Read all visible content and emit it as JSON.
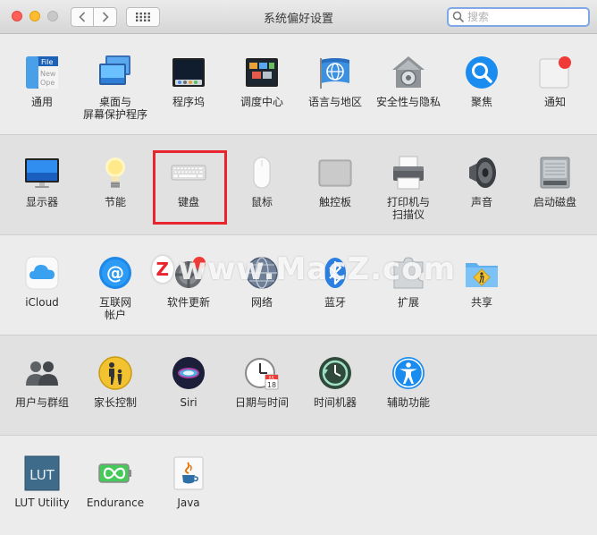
{
  "window": {
    "title": "系统偏好设置"
  },
  "search": {
    "placeholder": "搜索",
    "value": ""
  },
  "rows": [
    [
      {
        "label": "通用",
        "icon": "general-icon"
      },
      {
        "label": "桌面与\n屏幕保护程序",
        "icon": "desktop-screensaver-icon"
      },
      {
        "label": "程序坞",
        "icon": "dock-icon"
      },
      {
        "label": "调度中心",
        "icon": "mission-control-icon"
      },
      {
        "label": "语言与地区",
        "icon": "language-region-icon"
      },
      {
        "label": "安全性与隐私",
        "icon": "security-privacy-icon"
      },
      {
        "label": "聚焦",
        "icon": "spotlight-icon"
      },
      {
        "label": "通知",
        "icon": "notifications-icon"
      }
    ],
    [
      {
        "label": "显示器",
        "icon": "displays-icon"
      },
      {
        "label": "节能",
        "icon": "energy-saver-icon"
      },
      {
        "label": "键盘",
        "icon": "keyboard-icon"
      },
      {
        "label": "鼠标",
        "icon": "mouse-icon"
      },
      {
        "label": "触控板",
        "icon": "trackpad-icon"
      },
      {
        "label": "打印机与\n扫描仪",
        "icon": "printers-scanners-icon"
      },
      {
        "label": "声音",
        "icon": "sound-icon"
      },
      {
        "label": "启动磁盘",
        "icon": "startup-disk-icon"
      }
    ],
    [
      {
        "label": "iCloud",
        "icon": "icloud-icon"
      },
      {
        "label": "互联网\n帐户",
        "icon": "internet-accounts-icon"
      },
      {
        "label": "软件更新",
        "icon": "software-update-icon"
      },
      {
        "label": "网络",
        "icon": "network-icon"
      },
      {
        "label": "蓝牙",
        "icon": "bluetooth-icon"
      },
      {
        "label": "扩展",
        "icon": "extensions-icon"
      },
      {
        "label": "共享",
        "icon": "sharing-icon"
      }
    ],
    [
      {
        "label": "用户与群组",
        "icon": "users-groups-icon"
      },
      {
        "label": "家长控制",
        "icon": "parental-controls-icon"
      },
      {
        "label": "Siri",
        "icon": "siri-icon"
      },
      {
        "label": "日期与时间",
        "icon": "date-time-icon"
      },
      {
        "label": "时间机器",
        "icon": "time-machine-icon"
      },
      {
        "label": "辅助功能",
        "icon": "accessibility-icon"
      }
    ],
    [
      {
        "label": "LUT Utility",
        "icon": "lut-utility-icon"
      },
      {
        "label": "Endurance",
        "icon": "endurance-icon"
      },
      {
        "label": "Java",
        "icon": "java-icon"
      }
    ]
  ],
  "icon_text": {
    "general_file": "File",
    "general_new": "New",
    "general_ope": "Ope",
    "calendar_month": "JUL",
    "calendar_day": "18",
    "lut": "LUT"
  },
  "watermark": {
    "logo": "Z",
    "text": "www.MacZ.com"
  },
  "colors": {
    "highlight": "#e8242f",
    "accent": "#1a8cf0"
  }
}
